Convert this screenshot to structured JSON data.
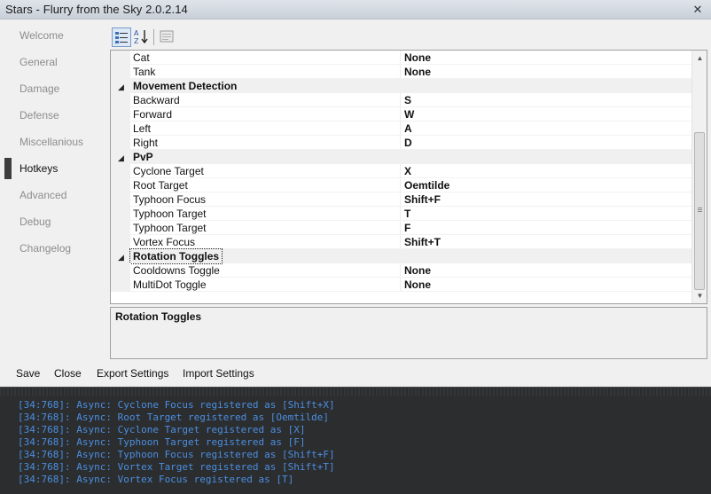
{
  "window": {
    "title": "Stars - Flurry from the Sky 2.0.2.14",
    "close_glyph": "✕"
  },
  "nav": {
    "items": [
      {
        "label": "Welcome",
        "active": false
      },
      {
        "label": "General",
        "active": false
      },
      {
        "label": "Damage",
        "active": false
      },
      {
        "label": "Defense",
        "active": false
      },
      {
        "label": "Miscellanious",
        "active": false
      },
      {
        "label": "Hotkeys",
        "active": true
      },
      {
        "label": "Advanced",
        "active": false
      },
      {
        "label": "Debug",
        "active": false
      },
      {
        "label": "Changelog",
        "active": false
      }
    ]
  },
  "toolbar": {
    "buttons": [
      "categorized-icon",
      "alphabetical-icon",
      "property-pages-icon"
    ]
  },
  "grid": {
    "rows": [
      {
        "type": "prop",
        "name": "Cat",
        "value": "None"
      },
      {
        "type": "prop",
        "name": "Tank",
        "value": "None"
      },
      {
        "type": "cat",
        "name": "Movement Detection"
      },
      {
        "type": "prop",
        "name": "Backward",
        "value": "S"
      },
      {
        "type": "prop",
        "name": "Forward",
        "value": "W"
      },
      {
        "type": "prop",
        "name": "Left",
        "value": "A"
      },
      {
        "type": "prop",
        "name": "Right",
        "value": "D"
      },
      {
        "type": "cat",
        "name": "PvP"
      },
      {
        "type": "prop",
        "name": "Cyclone Target",
        "value": "X"
      },
      {
        "type": "prop",
        "name": "Root Target",
        "value": "Oemtilde"
      },
      {
        "type": "prop",
        "name": "Typhoon Focus",
        "value": "Shift+F"
      },
      {
        "type": "prop",
        "name": "Typhoon Target",
        "value": "T"
      },
      {
        "type": "prop",
        "name": "Typhoon Target",
        "value": "F"
      },
      {
        "type": "prop",
        "name": "Vortex Focus",
        "value": "Shift+T"
      },
      {
        "type": "cat",
        "name": "Rotation Toggles",
        "focused": true
      },
      {
        "type": "prop",
        "name": "Cooldowns Toggle",
        "value": "None"
      },
      {
        "type": "prop",
        "name": "MultiDot Toggle",
        "value": "None"
      }
    ]
  },
  "description": {
    "title": "Rotation Toggles"
  },
  "footer": {
    "save": "Save",
    "close": "Close",
    "export": "Export Settings",
    "import": "Import Settings"
  },
  "console": {
    "lines": [
      "[34:768]: Async: Cyclone Focus registered as [Shift+X]",
      "[34:768]: Async: Root Target registered as [Oemtilde]",
      "[34:768]: Async: Cyclone Target registered as [X]",
      "[34:768]: Async: Typhoon Target registered as [F]",
      "[34:768]: Async: Typhoon Focus registered as [Shift+F]",
      "[34:768]: Async: Vortex Target registered as [Shift+T]",
      "[34:768]: Async: Vortex Focus registered as [T]"
    ]
  }
}
